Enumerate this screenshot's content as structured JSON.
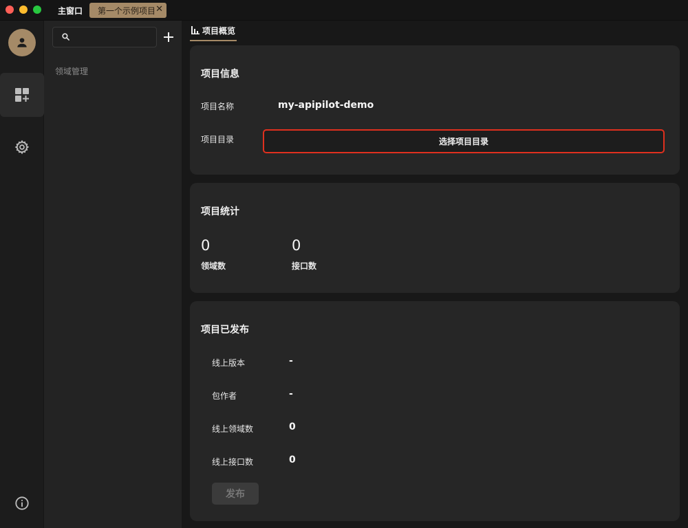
{
  "titlebar": {
    "main_window": "主窗口",
    "project_tab": "第一个示例项目",
    "close_glyph": "✕"
  },
  "rail": {
    "items": [
      {
        "icon": "user-avatar-icon"
      },
      {
        "icon": "add-widget-icon",
        "active": true
      },
      {
        "icon": "gear-icon"
      },
      {
        "icon": "info-icon"
      }
    ]
  },
  "sidebar": {
    "search_placeholder": "",
    "add_glyph": "+",
    "domain_manage": "领域管理"
  },
  "tabs": {
    "overview": "项目概览"
  },
  "project_info": {
    "title": "项目信息",
    "name_label": "项目名称",
    "name_value": "my-apipilot-demo",
    "dir_label": "项目目录",
    "dir_button": "选择项目目录"
  },
  "project_stats": {
    "title": "项目统计",
    "domain_count": "0",
    "domain_label": "领域数",
    "api_count": "0",
    "api_label": "接口数"
  },
  "project_published": {
    "title": "项目已发布",
    "rows": [
      {
        "label": "线上版本",
        "value": "-"
      },
      {
        "label": "包作者",
        "value": "-"
      },
      {
        "label": "线上领域数",
        "value": "0"
      },
      {
        "label": "线上接口数",
        "value": "0"
      }
    ],
    "publish_button": "发布"
  },
  "colors": {
    "accent": "#a58a67",
    "highlight_border": "#e0301e",
    "card_bg": "#262626"
  }
}
